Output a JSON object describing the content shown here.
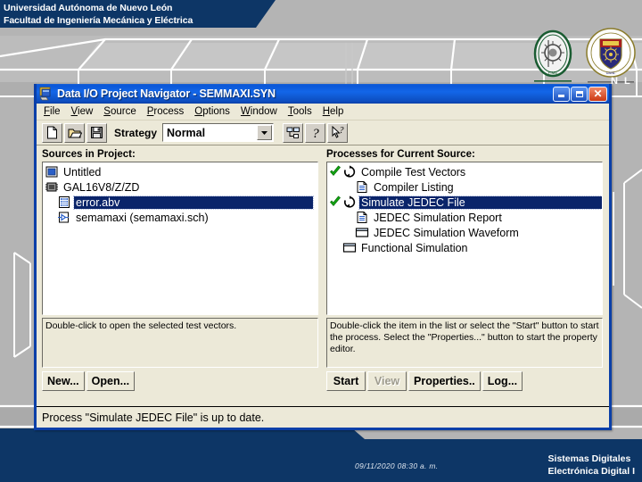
{
  "slide": {
    "header": {
      "line1": "Universidad Autónoma de Nuevo León",
      "line2": "Facultad de Ingeniería Mecánica y Eléctrica"
    },
    "footer": {
      "date": "09/11/2020 08:30 a. m.",
      "course_line1": "Sistemas Digitales",
      "course_line2": "Electrónica Digital I",
      "nl_mark": "N L"
    },
    "logos": {
      "fime": "fime-logo",
      "uanl": "uanl-shield-logo"
    },
    "colors": {
      "banner_navy": "#0d3666",
      "background_gray": "#b4b4b4",
      "title_blue": "#0a57d8",
      "selection_blue": "#0a246a",
      "window_face": "#ece9d8"
    }
  },
  "window": {
    "title": "Data I/O Project Navigator - SEMMAXI.SYN",
    "icon": "app-icon",
    "buttons": {
      "minimize": "minimize-button",
      "maximize": "maximize-button",
      "close": "close-button"
    },
    "menu": [
      {
        "label": "File",
        "mnemonic": "F",
        "rest": "ile"
      },
      {
        "label": "View",
        "mnemonic": "V",
        "rest": "iew"
      },
      {
        "label": "Source",
        "mnemonic": "S",
        "rest": "ource"
      },
      {
        "label": "Process",
        "mnemonic": "P",
        "rest": "rocess"
      },
      {
        "label": "Options",
        "mnemonic": "O",
        "rest": "ptions"
      },
      {
        "label": "Window",
        "mnemonic": "W",
        "rest": "indow"
      },
      {
        "label": "Tools",
        "mnemonic": "T",
        "rest": "ools"
      },
      {
        "label": "Help",
        "mnemonic": "H",
        "rest": "elp"
      }
    ],
    "toolbar": {
      "new_icon": "new-document-icon",
      "open_icon": "open-folder-icon",
      "save_icon": "save-disk-icon",
      "strategy_label": "Strategy",
      "strategy_value": "Normal",
      "strategy_options": [
        "Normal"
      ],
      "hierarchy_icon": "hierarchy-icon",
      "help_icon": "question-mark-icon",
      "context_help_icon": "pointer-question-icon"
    },
    "sources_pane": {
      "header": "Sources in Project:",
      "items": [
        {
          "label": "Untitled",
          "icon": "project-window-icon",
          "indent": 0,
          "selected": false
        },
        {
          "label": "GAL16V8/Z/ZD",
          "icon": "chip-icon",
          "indent": 0,
          "selected": false
        },
        {
          "label": "error.abv",
          "icon": "test-vector-icon",
          "indent": 1,
          "selected": true
        },
        {
          "label": "semamaxi (semamaxi.sch)",
          "icon": "schematic-icon",
          "indent": 1,
          "selected": false
        }
      ],
      "hint": "Double-click to open the selected test vectors.",
      "buttons": [
        {
          "label": "New...",
          "name": "new-button",
          "disabled": false
        },
        {
          "label": "Open...",
          "name": "open-button",
          "disabled": false
        }
      ]
    },
    "processes_pane": {
      "header": "Processes for Current Source:",
      "items": [
        {
          "label": "Compile Test Vectors",
          "icon": "process-refresh-icon",
          "check": true,
          "indent": 0,
          "selected": false
        },
        {
          "label": "Compiler Listing",
          "icon": "report-document-icon",
          "check": false,
          "indent": 1,
          "selected": false
        },
        {
          "label": "Simulate JEDEC File",
          "icon": "process-refresh-icon",
          "check": true,
          "indent": 0,
          "selected": true
        },
        {
          "label": "JEDEC Simulation Report",
          "icon": "report-document-icon",
          "check": false,
          "indent": 1,
          "selected": false
        },
        {
          "label": "JEDEC Simulation Waveform",
          "icon": "waveform-window-icon",
          "check": false,
          "indent": 1,
          "selected": false
        },
        {
          "label": "Functional Simulation",
          "icon": "waveform-window-icon",
          "check": false,
          "indent": 0,
          "selected": false
        }
      ],
      "hint": "Double-click the item in the list or select the \"Start\" button to start the process.  Select the \"Properties...\" button to start the property editor.",
      "buttons": [
        {
          "label": "Start",
          "name": "start-button",
          "disabled": false
        },
        {
          "label": "View",
          "name": "view-button",
          "disabled": true
        },
        {
          "label": "Properties..",
          "name": "properties-button",
          "disabled": false
        },
        {
          "label": "Log...",
          "name": "log-button",
          "disabled": false
        }
      ]
    },
    "status": "Process \"Simulate JEDEC File\" is up to date."
  }
}
